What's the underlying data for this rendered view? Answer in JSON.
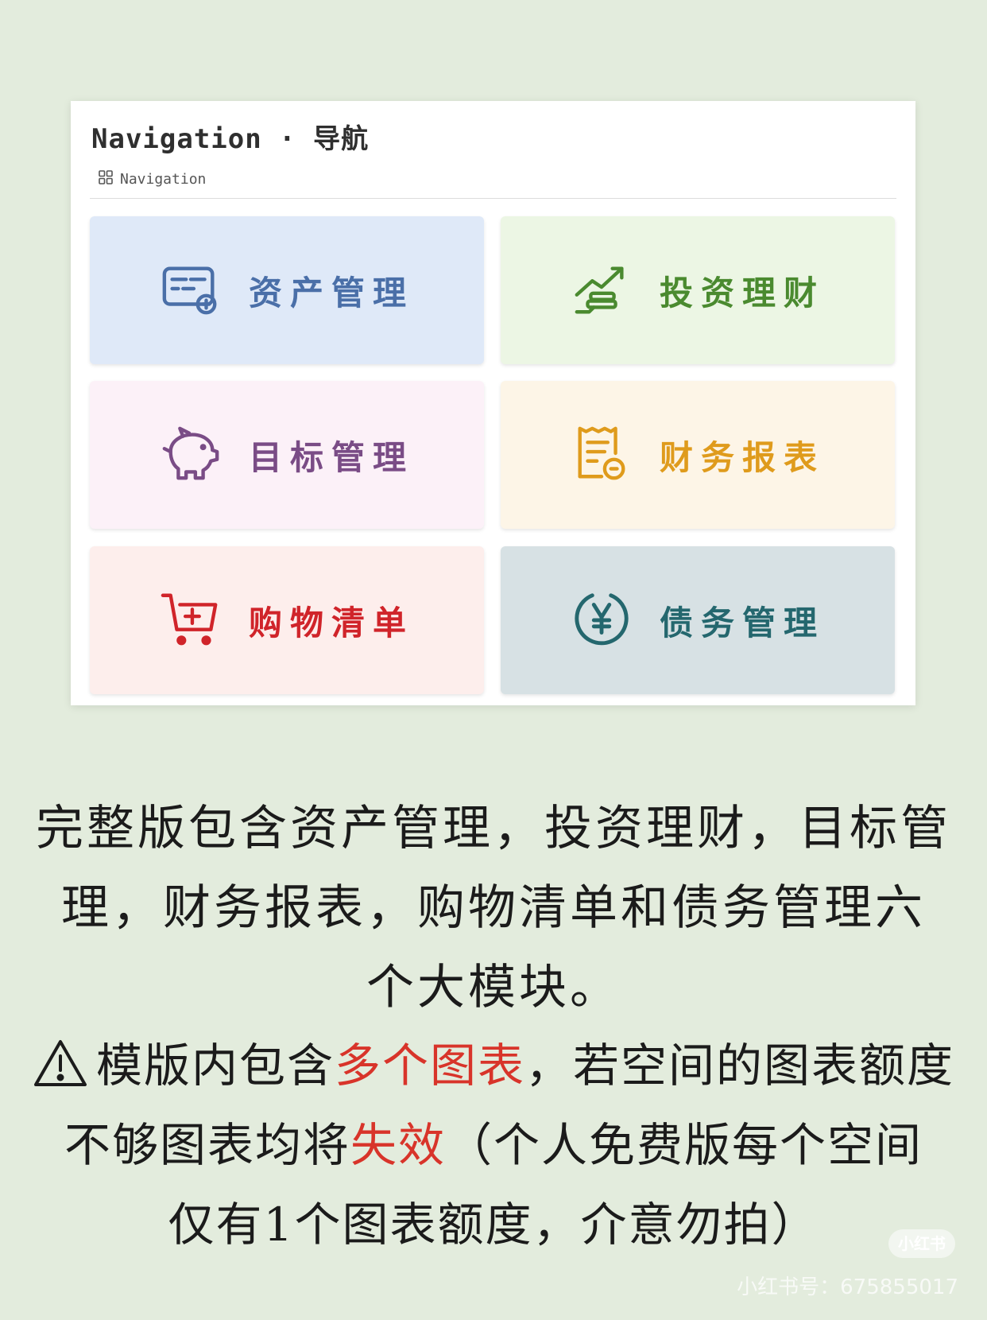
{
  "page": {
    "title": "Navigation · 导航",
    "tab": {
      "label": "Navigation",
      "icon": "grid-icon"
    }
  },
  "tiles": [
    {
      "label": "资产管理",
      "icon": "wallet-card-icon",
      "color": "#4a6fa8",
      "bg": "#dfe9f8"
    },
    {
      "label": "投资理财",
      "icon": "growth-arrow-icon",
      "color": "#4a8a2f",
      "bg": "#ecf6e4"
    },
    {
      "label": "目标管理",
      "icon": "piggy-bank-icon",
      "color": "#7a4c86",
      "bg": "#fcf1f8"
    },
    {
      "label": "财务报表",
      "icon": "receipt-report-icon",
      "color": "#df9b1c",
      "bg": "#fdf5e7"
    },
    {
      "label": "购物清单",
      "icon": "shopping-cart-icon",
      "color": "#d0242a",
      "bg": "#fdeeec"
    },
    {
      "label": "债务管理",
      "icon": "yen-circle-icon",
      "color": "#24676e",
      "bg": "#d7e1e4"
    }
  ],
  "description": {
    "line1": "完整版包含资产管理，投资理财，目标管",
    "line2": "理，财务报表，购物清单和债务管理六",
    "line3": "个大模块。"
  },
  "warning": {
    "icon": "warning-triangle-icon",
    "part1": "模版内包含",
    "highlight1": "多个图表",
    "part2": "，若空间的图表额度",
    "part3": "不够图表均将",
    "highlight2": "失效",
    "part4": "（个人免费版每个空间",
    "part5": "仅有1个图表额度，介意勿拍）"
  },
  "watermark": {
    "brand": "小红书",
    "id_text": "小红书号：675855017"
  }
}
